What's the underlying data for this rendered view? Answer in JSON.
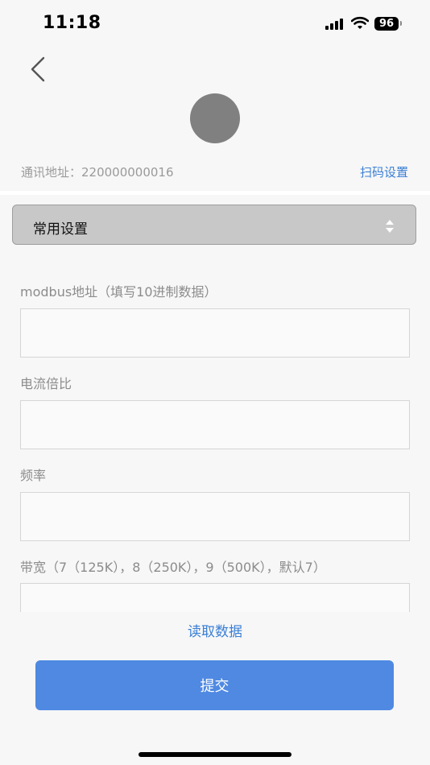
{
  "status_bar": {
    "time": "11:18",
    "battery": "96"
  },
  "header": {
    "back_icon": "chevron-left-icon",
    "avatar_color": "#808080"
  },
  "device": {
    "address_label": "通讯地址：220000000016",
    "scan_settings": "扫码设置"
  },
  "settings_select": {
    "selected": "常用设置"
  },
  "fields": [
    {
      "label": "modbus地址（填写10进制数据）",
      "value": "",
      "placeholder": ""
    },
    {
      "label": "电流倍比",
      "value": "",
      "placeholder": ""
    },
    {
      "label": "频率",
      "value": "",
      "placeholder": ""
    },
    {
      "label": "带宽（7（125K），8（250K），9（500K），默认7）",
      "value": "",
      "placeholder": ""
    }
  ],
  "actions": {
    "read_data": "读取数据",
    "submit": "提交"
  },
  "colors": {
    "accent": "#4f89e2",
    "link": "#3a7fd5",
    "select_bg": "#c8c8c8"
  }
}
